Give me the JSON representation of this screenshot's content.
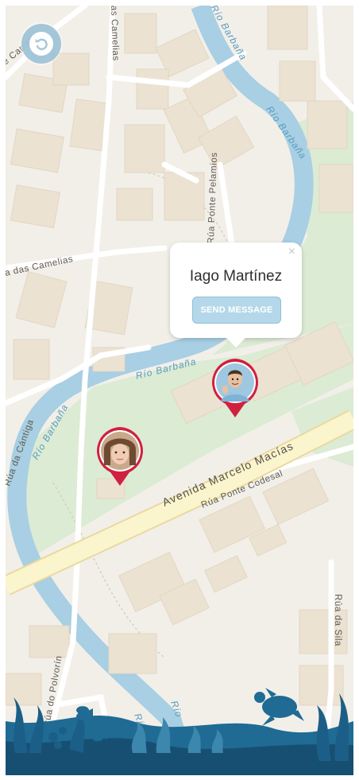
{
  "map": {
    "streets": {
      "camelias_top": "as Camelias",
      "camelias_left": "a das Camelias",
      "corral_top": "e Carral",
      "ponte_pelamios": "Rúa Ponte Pelamios",
      "cantiga": "Rúa da Cántiga",
      "polvorin": "Rúa do Polvorín",
      "sila": "Rúa da Sila",
      "codesal": "Rúa Ponte Codesal",
      "avenida": "Avenida Marcelo Macías"
    },
    "rivers": {
      "barbana_1": "Río Barbaña",
      "barbana_2": "Río Barbaña",
      "barbana_3": "Río Barbaña",
      "barbana_4": "Río Barbaña",
      "barbana_5": "Río",
      "barbana_6": "Río"
    },
    "colors": {
      "land": "#f2efe9",
      "park": "#dcebd4",
      "river": "#a8cfe3",
      "building": "#ece2d2",
      "road_major": "#faf3c8",
      "pin": "#d02040"
    }
  },
  "popup": {
    "name": "Iago Martínez",
    "button_label": "SEND MESSAGE",
    "close_glyph": "×"
  },
  "controls": {
    "back_icon": "undo-icon"
  },
  "pins": [
    {
      "person": "Iago Martínez",
      "icon": "male-avatar"
    },
    {
      "person": "female contact",
      "icon": "female-avatar"
    }
  ]
}
